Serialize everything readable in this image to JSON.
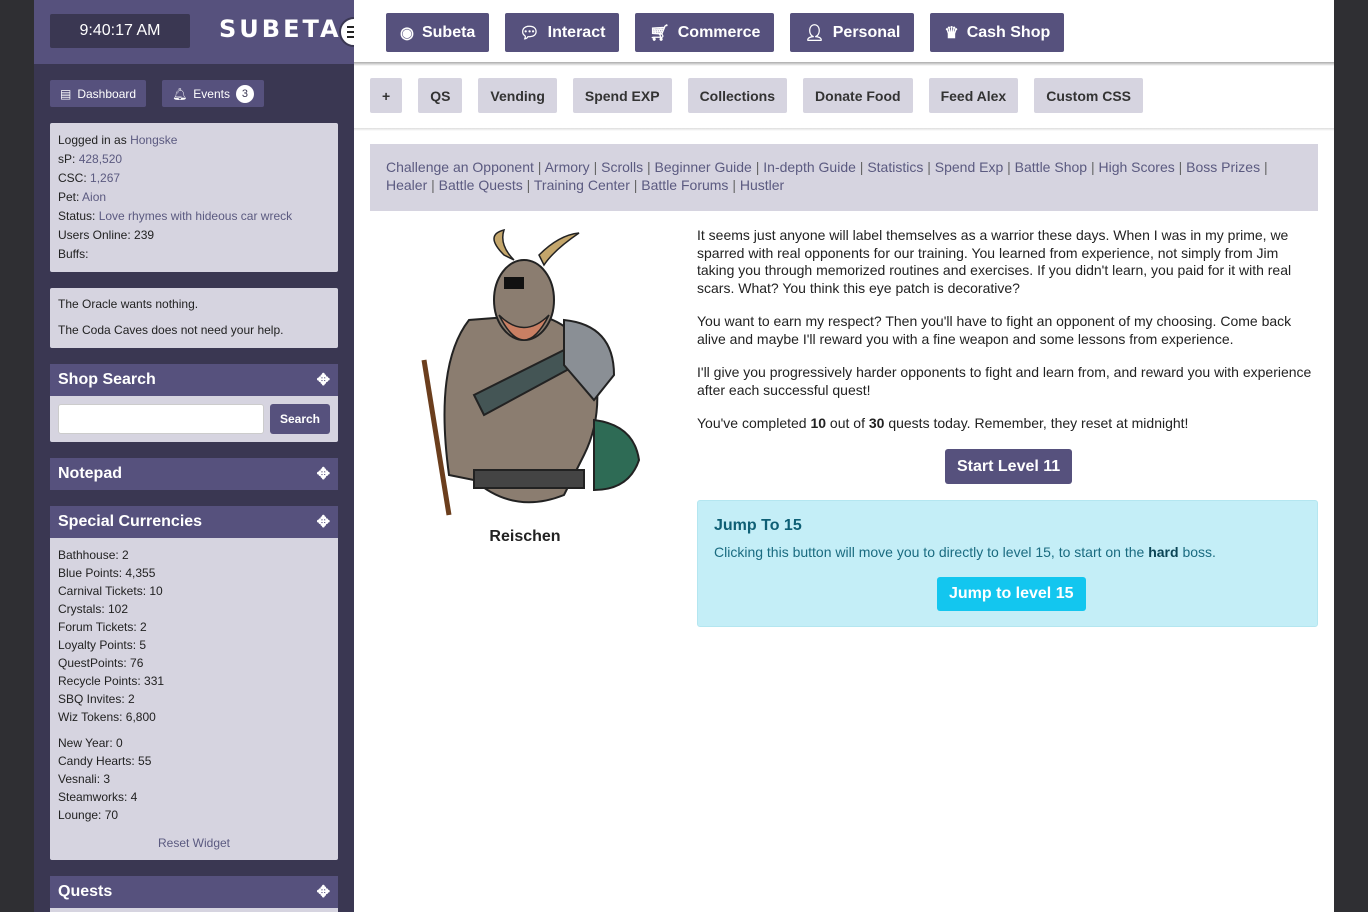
{
  "header": {
    "time": "9:40:17 AM",
    "logo": "SUBETA"
  },
  "top_nav": [
    {
      "label": "Subeta",
      "icon": "compass-icon"
    },
    {
      "label": "Interact",
      "icon": "chat-icon"
    },
    {
      "label": "Commerce",
      "icon": "cart-icon"
    },
    {
      "label": "Personal",
      "icon": "user-icon"
    },
    {
      "label": "Cash Shop",
      "icon": "crown-icon"
    }
  ],
  "side_buttons": {
    "dashboard": "Dashboard",
    "events": "Events",
    "events_count": "3"
  },
  "user_info": {
    "logged_in_label": "Logged in as",
    "username": "Hongske",
    "sp_label": "sP:",
    "sp": "428,520",
    "csc_label": "CSC:",
    "csc": "1,267",
    "pet_label": "Pet:",
    "pet": "Aion",
    "status_label": "Status:",
    "status": "Love rhymes with hideous car wreck",
    "users_online": "Users Online: 239",
    "buffs": "Buffs:"
  },
  "notices": {
    "oracle": "The Oracle wants nothing.",
    "coda": "The Coda Caves does not need your help."
  },
  "shop_search": {
    "title": "Shop Search",
    "button": "Search",
    "placeholder": ""
  },
  "notepad": {
    "title": "Notepad"
  },
  "special_currencies": {
    "title": "Special Currencies",
    "group1": [
      "Bathhouse: 2",
      "Blue Points: 4,355",
      "Carnival Tickets: 10",
      "Crystals: 102",
      "Forum Tickets: 2",
      "Loyalty Points: 5",
      "QuestPoints: 76",
      "Recycle Points: 331",
      "SBQ Invites: 2",
      "Wiz Tokens: 6,800"
    ],
    "group2": [
      "New Year: 0",
      "Candy Hearts: 55",
      "Vesnali: 3",
      "Steamworks: 4",
      "Lounge: 70"
    ],
    "reset": "Reset Widget"
  },
  "quests_widget": {
    "title": "Quests"
  },
  "sub_nav": [
    "+",
    "QS",
    "Vending",
    "Spend EXP",
    "Collections",
    "Donate Food",
    "Feed Alex",
    "Custom CSS"
  ],
  "battle_links": [
    "Challenge an Opponent",
    "Armory",
    "Scrolls",
    "Beginner Guide",
    "In-depth Guide",
    "Statistics",
    "Spend Exp",
    "Battle Shop",
    "High Scores",
    "Boss Prizes",
    "Healer",
    "Battle Quests",
    "Training Center",
    "Battle Forums",
    "Hustler"
  ],
  "character": {
    "name": "Reischen"
  },
  "story": {
    "p1": "It seems just anyone will label themselves as a warrior these days. When I was in my prime, we sparred with real opponents for our training. You learned from experience, not simply from Jim taking you through memorized routines and exercises. If you didn't learn, you paid for it with real scars. What? You think this eye patch is decorative?",
    "p2": "You want to earn my respect? Then you'll have to fight an opponent of my choosing. Come back alive and maybe I'll reward you with a fine weapon and some lessons from experience.",
    "p3": "I'll give you progressively harder opponents to fight and learn from, and reward you with experience after each successful quest!",
    "p4_pre": "You've completed ",
    "completed": "10",
    "p4_mid": " out of ",
    "total": "30",
    "p4_post": " quests today. Remember, they reset at midnight!"
  },
  "start_button": "Start Level 11",
  "jump_box": {
    "title": "Jump To 15",
    "desc_pre": "Clicking this button will move you to directly to level 15, to start on the ",
    "desc_bold": "hard",
    "desc_post": " boss.",
    "button": "Jump to level 15"
  },
  "colors": {
    "accent": "#56517d",
    "sidebar": "#3a3752",
    "panel": "#d6d4e0",
    "info_bg": "#c4eef7",
    "info_button": "#13c6ef"
  }
}
